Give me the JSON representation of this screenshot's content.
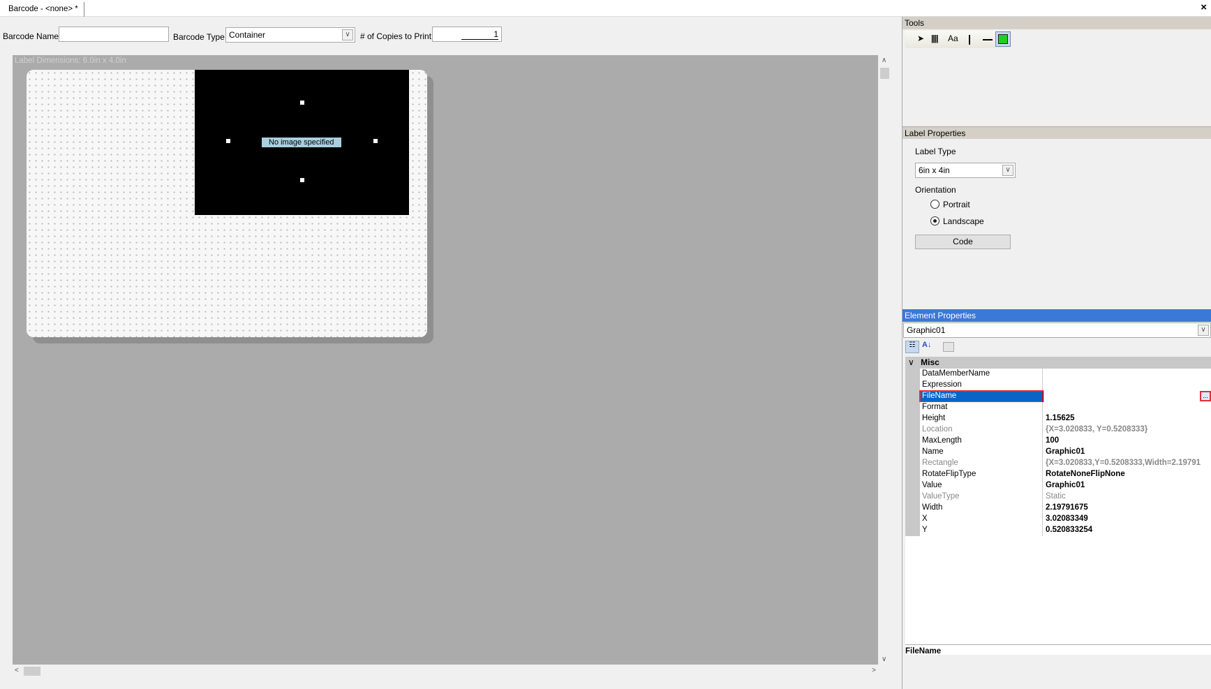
{
  "tab": {
    "title": "Barcode - <none> *",
    "close": "×"
  },
  "toolbar": {
    "barcode_name_label": "Barcode Name",
    "barcode_name_value": "",
    "barcode_type_label": "Barcode Type",
    "barcode_type_value": "Container",
    "copies_label": "# of Copies to Print",
    "copies_value": "1"
  },
  "canvas": {
    "dimensions": "Label Dimensions: 6.0in x 4.0in",
    "graphic_text": "No image specified"
  },
  "tools": {
    "header": "Tools",
    "items": [
      "pointer",
      "barcode",
      "text",
      "vertical-line",
      "horizontal-line",
      "image"
    ],
    "text_label": "Aa",
    "selected": "image"
  },
  "label_properties": {
    "header": "Label Properties",
    "label_type_label": "Label Type",
    "label_type_value": "6in x 4in",
    "orientation_label": "Orientation",
    "portrait": "Portrait",
    "landscape": "Landscape",
    "selected": "Landscape",
    "code_button": "Code"
  },
  "element_properties": {
    "header": "Element Properties",
    "selected_element": "Graphic01",
    "category": "Misc",
    "rows": [
      {
        "name": "DataMemberName",
        "value": ""
      },
      {
        "name": "Expression",
        "value": ""
      },
      {
        "name": "FileName",
        "value": ""
      },
      {
        "name": "Format",
        "value": ""
      },
      {
        "name": "Height",
        "value": "1.15625"
      },
      {
        "name": "Location",
        "value": "{X=3.020833, Y=0.5208333}"
      },
      {
        "name": "MaxLength",
        "value": "100"
      },
      {
        "name": "Name",
        "value": "Graphic01"
      },
      {
        "name": "Rectangle",
        "value": "{X=3.020833,Y=0.5208333,Width=2.19791"
      },
      {
        "name": "RotateFlipType",
        "value": "RotateNoneFlipNone"
      },
      {
        "name": "Value",
        "value": "Graphic01"
      },
      {
        "name": "ValueType",
        "value": "Static"
      },
      {
        "name": "Width",
        "value": "2.19791675"
      },
      {
        "name": "X",
        "value": "3.02083349"
      },
      {
        "name": "Y",
        "value": "0.520833254"
      }
    ],
    "ellipsis": "...",
    "description_title": "FileName"
  },
  "colors": {
    "selection": "#0a64c8",
    "highlight_border": "#e0303a",
    "header_blue": "#3c78d8"
  }
}
